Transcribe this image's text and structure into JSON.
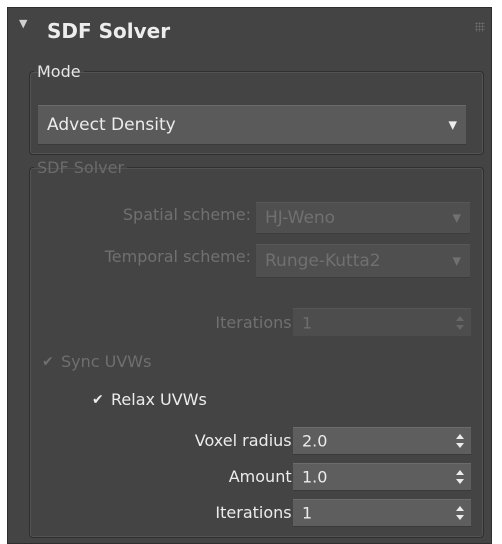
{
  "rollout": {
    "title": "SDF Solver",
    "collapse_icon": "triangle-down",
    "grip_icon": "drag-grip"
  },
  "mode": {
    "legend": "Mode",
    "dropdown_value": "Advect Density",
    "arrow": "▼"
  },
  "solver": {
    "legend": "SDF Solver",
    "spatial_label": "Spatial scheme:",
    "spatial_value": "HJ-Weno",
    "temporal_label": "Temporal scheme:",
    "temporal_value": "Runge-Kutta2",
    "iterations_label": "Iterations:",
    "iterations_value": "1",
    "sync_uvws_label": "Sync UVWs",
    "sync_uvws_checked": true,
    "relax_uvws_label": "Relax UVWs",
    "relax_uvws_checked": true,
    "voxel_radius_label": "Voxel radius:",
    "voxel_radius_value": "2.0",
    "amount_label": "Amount:",
    "amount_value": "1.0",
    "relax_iterations_label": "Iterations:",
    "relax_iterations_value": "1",
    "arrow": "▼",
    "check_glyph": "✔"
  },
  "colors": {
    "panel_bg": "#444444",
    "text_active": "#ececec",
    "text_disabled": "#707070"
  }
}
